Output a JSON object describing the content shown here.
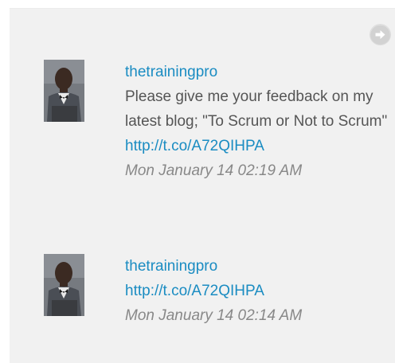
{
  "nav": {
    "next_icon": "arrow-right-circle-icon"
  },
  "tweets": [
    {
      "username": "thetrainingpro",
      "text": "Please give me your feedback on my latest blog; \"To Scrum or Not to Scrum\"",
      "url": "http://t.co/A72QIHPA",
      "timestamp": "Mon January 14 02:19 AM",
      "avatar_icon": "user-avatar"
    },
    {
      "username": "thetrainingpro",
      "url": "http://t.co/A72QIHPA",
      "timestamp": "Mon January 14 02:14 AM",
      "avatar_icon": "user-avatar"
    }
  ],
  "colors": {
    "panel_bg": "#f1f1f1",
    "link": "#1a8cc2",
    "text": "#555555",
    "timestamp": "#888888"
  }
}
